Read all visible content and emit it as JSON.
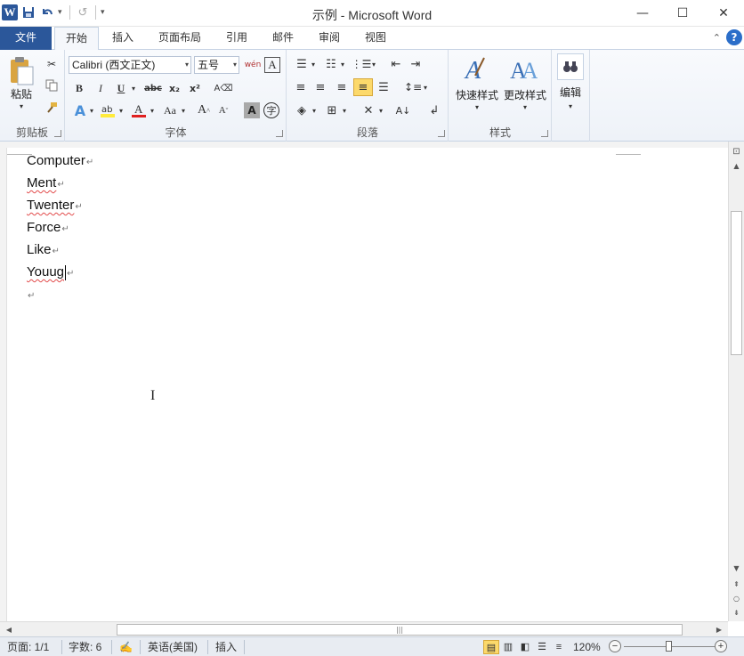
{
  "window": {
    "title": "示例 - Microsoft Word",
    "minimize": "—",
    "maximize": "☐",
    "close": "✕"
  },
  "qat": {
    "logo": "W",
    "save_icon": "floppy-icon",
    "undo_icon": "undo-icon",
    "redo_icon": "redo-icon"
  },
  "tabs": [
    {
      "label": "文件"
    },
    {
      "label": "开始"
    },
    {
      "label": "插入"
    },
    {
      "label": "页面布局"
    },
    {
      "label": "引用"
    },
    {
      "label": "邮件"
    },
    {
      "label": "审阅"
    },
    {
      "label": "视图"
    }
  ],
  "ribbon": {
    "clipboard": {
      "label": "剪贴板",
      "paste": "粘贴"
    },
    "font": {
      "label": "字体",
      "font_name": "Calibri (西文正文)",
      "font_size": "五号"
    },
    "paragraph": {
      "label": "段落"
    },
    "styles": {
      "label": "样式",
      "quick_styles": "快速样式",
      "change_styles": "更改样式"
    },
    "editing": {
      "label": "编辑"
    }
  },
  "document": {
    "lines": [
      "Computer",
      "Ment",
      "Twenter",
      "Force",
      "Like",
      "Youug"
    ],
    "misspelled": [
      "Ment",
      "Twenter",
      "Youug"
    ]
  },
  "status": {
    "page": "页面: 1/1",
    "words": "字数: 6",
    "language": "英语(美国)",
    "insert_mode": "插入",
    "zoom": "120%"
  },
  "colors": {
    "accent": "#2b579a",
    "ribbon_bg": "#f5f7fb",
    "status_bg": "#e8ecf2",
    "spell_error": "#e24b4b"
  }
}
